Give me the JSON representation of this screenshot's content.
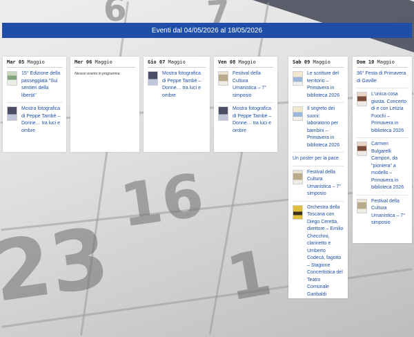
{
  "banner": {
    "title": "Eventi dal 04/05/2026 al 18/05/2026"
  },
  "days": [
    {
      "head_day": "Mar 05",
      "head_month": "Maggio",
      "events": [
        {
          "title": "15° Edizione della passeggiata \"Sui sentieri della libertà\"",
          "icon": "event-thumbnail-icon"
        },
        {
          "title": "Mostra fotografica di Peppe Tambè – Donne… tra luci e ombre",
          "icon": "event-thumbnail-icon"
        }
      ]
    },
    {
      "head_day": "Mer 06",
      "head_month": "Maggio",
      "empty": "Nessun evento in programma",
      "events": []
    },
    {
      "head_day": "Gio 07",
      "head_month": "Maggio",
      "events": [
        {
          "title": "Mostra fotografica di Peppe Tambè – Donne… tra luci e ombre",
          "icon": "event-thumbnail-icon"
        }
      ]
    },
    {
      "head_day": "Ven 08",
      "head_month": "Maggio",
      "events": [
        {
          "title": "Festival della Cultura Umanistica – 7° simposio",
          "icon": "event-thumbnail-icon"
        },
        {
          "title": "Mostra fotografica di Peppe Tambè – Donne… tra luci e ombre",
          "icon": "event-thumbnail-icon"
        }
      ]
    },
    {
      "head_day": "Sab 09",
      "head_month": "Maggio",
      "events": [
        {
          "title": "Le scritture del territorio – Primavera in biblioteca 2026",
          "icon": "event-thumbnail-icon"
        },
        {
          "title": "Il segreto dei suoni: laboratorio per bambini – Primavera in biblioteca 2026",
          "icon": "event-thumbnail-icon"
        },
        {
          "title": "Un poster per la pace"
        },
        {
          "title": "Festival della Cultura Umanistica – 7° simposio",
          "icon": "event-thumbnail-icon"
        },
        {
          "title": "Orchestra della Toscana con Diego Ceretta, direttore – Emilio Checchini, clarinetto e Umberto Codecà, fagotto – Stagione Concertistica del Teatro Comunale Garibaldi",
          "icon": "event-poster-icon"
        }
      ]
    },
    {
      "head_day": "Dom 10",
      "head_month": "Maggio",
      "events": [
        {
          "title": "36° Festa di Primavera di Gaville"
        },
        {
          "title": "L'unica cosa giusta. Concerto di e con Letizia Fuochi – Primavera in biblioteca 2026",
          "icon": "event-thumbnail-icon"
        },
        {
          "title": "Carmen Bulgarelli Campori, da \"pioniera\" a modello – Primavera in biblioteca 2026",
          "icon": "event-thumbnail-icon"
        },
        {
          "title": "Festival della Cultura Umanistica – 7° simposio",
          "icon": "event-thumbnail-icon"
        }
      ]
    }
  ]
}
